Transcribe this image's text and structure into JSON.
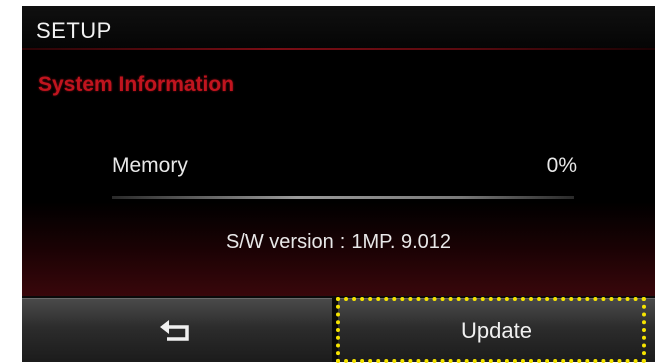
{
  "header": {
    "title": "SETUP"
  },
  "section": {
    "title": "System Information"
  },
  "memory": {
    "label": "Memory",
    "value": "0%",
    "fraction": 0
  },
  "software": {
    "label": "S/W version",
    "separator": ":",
    "version": "1MP. 9.012"
  },
  "buttons": {
    "back_icon": "back-arrow-icon",
    "update_label": "Update"
  },
  "colors": {
    "accent": "#c0141e",
    "highlight": "#f6e400"
  }
}
